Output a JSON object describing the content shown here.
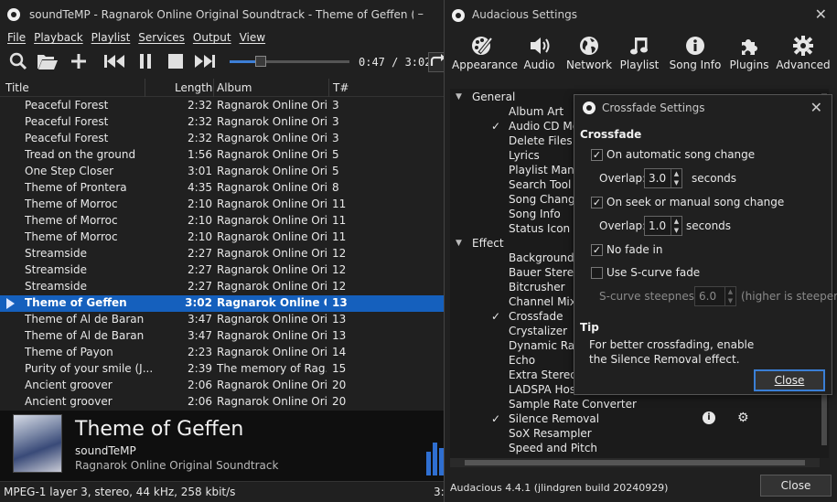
{
  "player": {
    "window_title": "soundTeMP - Ragnarok Online Original Soundtrack - Theme of Geffen (3:...",
    "minimize_glyph": "–",
    "menu": [
      "File",
      "Playback",
      "Playlist",
      "Services",
      "Output",
      "View"
    ],
    "toolbar_icons": [
      "search-icon",
      "open-folder-icon",
      "add-icon",
      "previous-icon",
      "pause-icon",
      "stop-icon",
      "next-icon"
    ],
    "seek_fraction": 0.256,
    "time": "0:47 / 3:02",
    "columns": {
      "title": "Title",
      "length": "Length",
      "album": "Album",
      "number": "T#"
    },
    "rows": [
      {
        "title": "Peaceful Forest",
        "length": "2:32",
        "album": "Ragnarok Online Ori...",
        "num": "3"
      },
      {
        "title": "Peaceful Forest",
        "length": "2:32",
        "album": "Ragnarok Online Ori...",
        "num": "3"
      },
      {
        "title": "Peaceful Forest",
        "length": "2:32",
        "album": "Ragnarok Online Ori...",
        "num": "3"
      },
      {
        "title": "Tread on the ground",
        "length": "1:56",
        "album": "Ragnarok Online Ori...",
        "num": "5"
      },
      {
        "title": "One Step Closer",
        "length": "3:01",
        "album": "Ragnarok Online Ori...",
        "num": "5"
      },
      {
        "title": "Theme of Prontera",
        "length": "4:35",
        "album": "Ragnarok Online Ori...",
        "num": "8"
      },
      {
        "title": "Theme of Morroc",
        "length": "2:10",
        "album": "Ragnarok Online Ori...",
        "num": "11"
      },
      {
        "title": "Theme of Morroc",
        "length": "2:10",
        "album": "Ragnarok Online Ori...",
        "num": "11"
      },
      {
        "title": "Theme of Morroc",
        "length": "2:10",
        "album": "Ragnarok Online Ori...",
        "num": "11"
      },
      {
        "title": "Streamside",
        "length": "2:27",
        "album": "Ragnarok Online Ori...",
        "num": "12"
      },
      {
        "title": "Streamside",
        "length": "2:27",
        "album": "Ragnarok Online Ori...",
        "num": "12"
      },
      {
        "title": "Streamside",
        "length": "2:27",
        "album": "Ragnarok Online Ori...",
        "num": "12"
      },
      {
        "title": "Theme of Geffen",
        "length": "3:02",
        "album": "Ragnarok Online O...",
        "num": "13",
        "playing": true
      },
      {
        "title": "Theme of Al de Baran",
        "length": "3:47",
        "album": "Ragnarok Online Ori...",
        "num": "13"
      },
      {
        "title": "Theme of Al de Baran",
        "length": "3:47",
        "album": "Ragnarok Online Ori...",
        "num": "13"
      },
      {
        "title": "Theme of Payon",
        "length": "2:23",
        "album": "Ragnarok Online Ori...",
        "num": "14"
      },
      {
        "title": "Purity of your smile (J...",
        "length": "2:39",
        "album": "The memory of Rag...",
        "num": "15"
      },
      {
        "title": "Ancient groover",
        "length": "2:06",
        "album": "Ragnarok Online Ori...",
        "num": "20"
      },
      {
        "title": "Ancient groover",
        "length": "2:06",
        "album": "Ragnarok Online Ori...",
        "num": "20"
      }
    ],
    "now_playing": {
      "title": "Theme of Geffen",
      "artist": "soundTeMP",
      "album": "Ragnarok Online Original Soundtrack"
    },
    "status": "MPEG-1 layer 3, stereo, 44 kHz, 258 kbit/s",
    "status_edge": "3:"
  },
  "settings": {
    "title": "Audacious Settings",
    "close_glyph": "✕",
    "categories": [
      {
        "label": "Appearance",
        "icon": "palette-icon"
      },
      {
        "label": "Audio",
        "icon": "speaker-icon"
      },
      {
        "label": "Network",
        "icon": "globe-icon"
      },
      {
        "label": "Playlist",
        "icon": "music-note-icon"
      },
      {
        "label": "Song Info",
        "icon": "info-icon"
      },
      {
        "label": "Plugins",
        "icon": "puzzle-icon"
      },
      {
        "label": "Advanced",
        "icon": "gear-icon"
      }
    ],
    "tree": [
      {
        "type": "group",
        "label": "General"
      },
      {
        "type": "item",
        "label": "Album Art",
        "checked": false
      },
      {
        "type": "item",
        "label": "Audio CD Men",
        "checked": true
      },
      {
        "type": "item",
        "label": "Delete Files",
        "checked": false
      },
      {
        "type": "item",
        "label": "Lyrics",
        "checked": false
      },
      {
        "type": "item",
        "label": "Playlist Manag",
        "checked": false
      },
      {
        "type": "item",
        "label": "Search Tool",
        "checked": false
      },
      {
        "type": "item",
        "label": "Song Change",
        "checked": false
      },
      {
        "type": "item",
        "label": "Song Info",
        "checked": false
      },
      {
        "type": "item",
        "label": "Status Icon",
        "checked": false
      },
      {
        "type": "group",
        "label": "Effect"
      },
      {
        "type": "item",
        "label": "Background M",
        "checked": false
      },
      {
        "type": "item",
        "label": "Bauer Stereop",
        "checked": false
      },
      {
        "type": "item",
        "label": "Bitcrusher",
        "checked": false
      },
      {
        "type": "item",
        "label": "Channel Mixe",
        "checked": false
      },
      {
        "type": "item",
        "label": "Crossfade",
        "checked": true
      },
      {
        "type": "item",
        "label": "Crystalizer",
        "checked": false
      },
      {
        "type": "item",
        "label": "Dynamic Rang",
        "checked": false
      },
      {
        "type": "item",
        "label": "Echo",
        "checked": false
      },
      {
        "type": "item",
        "label": "Extra Stereo",
        "checked": false
      },
      {
        "type": "item",
        "label": "LADSPA Host",
        "checked": false
      },
      {
        "type": "item",
        "label": "Sample Rate Converter",
        "checked": false
      },
      {
        "type": "item",
        "label": "Silence Removal",
        "checked": true,
        "tools": true
      },
      {
        "type": "item",
        "label": "SoX Resampler",
        "checked": false
      },
      {
        "type": "item",
        "label": "Speed and Pitch",
        "checked": false
      }
    ],
    "version": "Audacious 4.4.1 (jlindgren build 20240929)",
    "close_button": "Close"
  },
  "crossfade": {
    "title": "Crossfade Settings",
    "close_glyph": "✕",
    "section": "Crossfade",
    "auto_change": {
      "label": "On automatic song change",
      "checked": true
    },
    "overlap_label": "Overlap:",
    "overlap1": "3.0",
    "seconds": "seconds",
    "manual_change": {
      "label": "On seek or manual song change",
      "checked": true
    },
    "overlap2": "1.0",
    "no_fade_in": {
      "label": "No fade in",
      "checked": true
    },
    "s_curve": {
      "label": "Use S-curve fade",
      "checked": false
    },
    "steepness_label": "S-curve steepness:",
    "steepness_value": "6.0",
    "steepness_hint": "(higher is steeper)",
    "tip_head": "Tip",
    "tip_line1": "For better crossfading, enable",
    "tip_line2": "the Silence Removal effect.",
    "close_button": "Close",
    "check_glyph": "✓"
  },
  "colors": {
    "selection": "#1560bd",
    "accent": "#3d7fd6",
    "background": "#202020"
  }
}
